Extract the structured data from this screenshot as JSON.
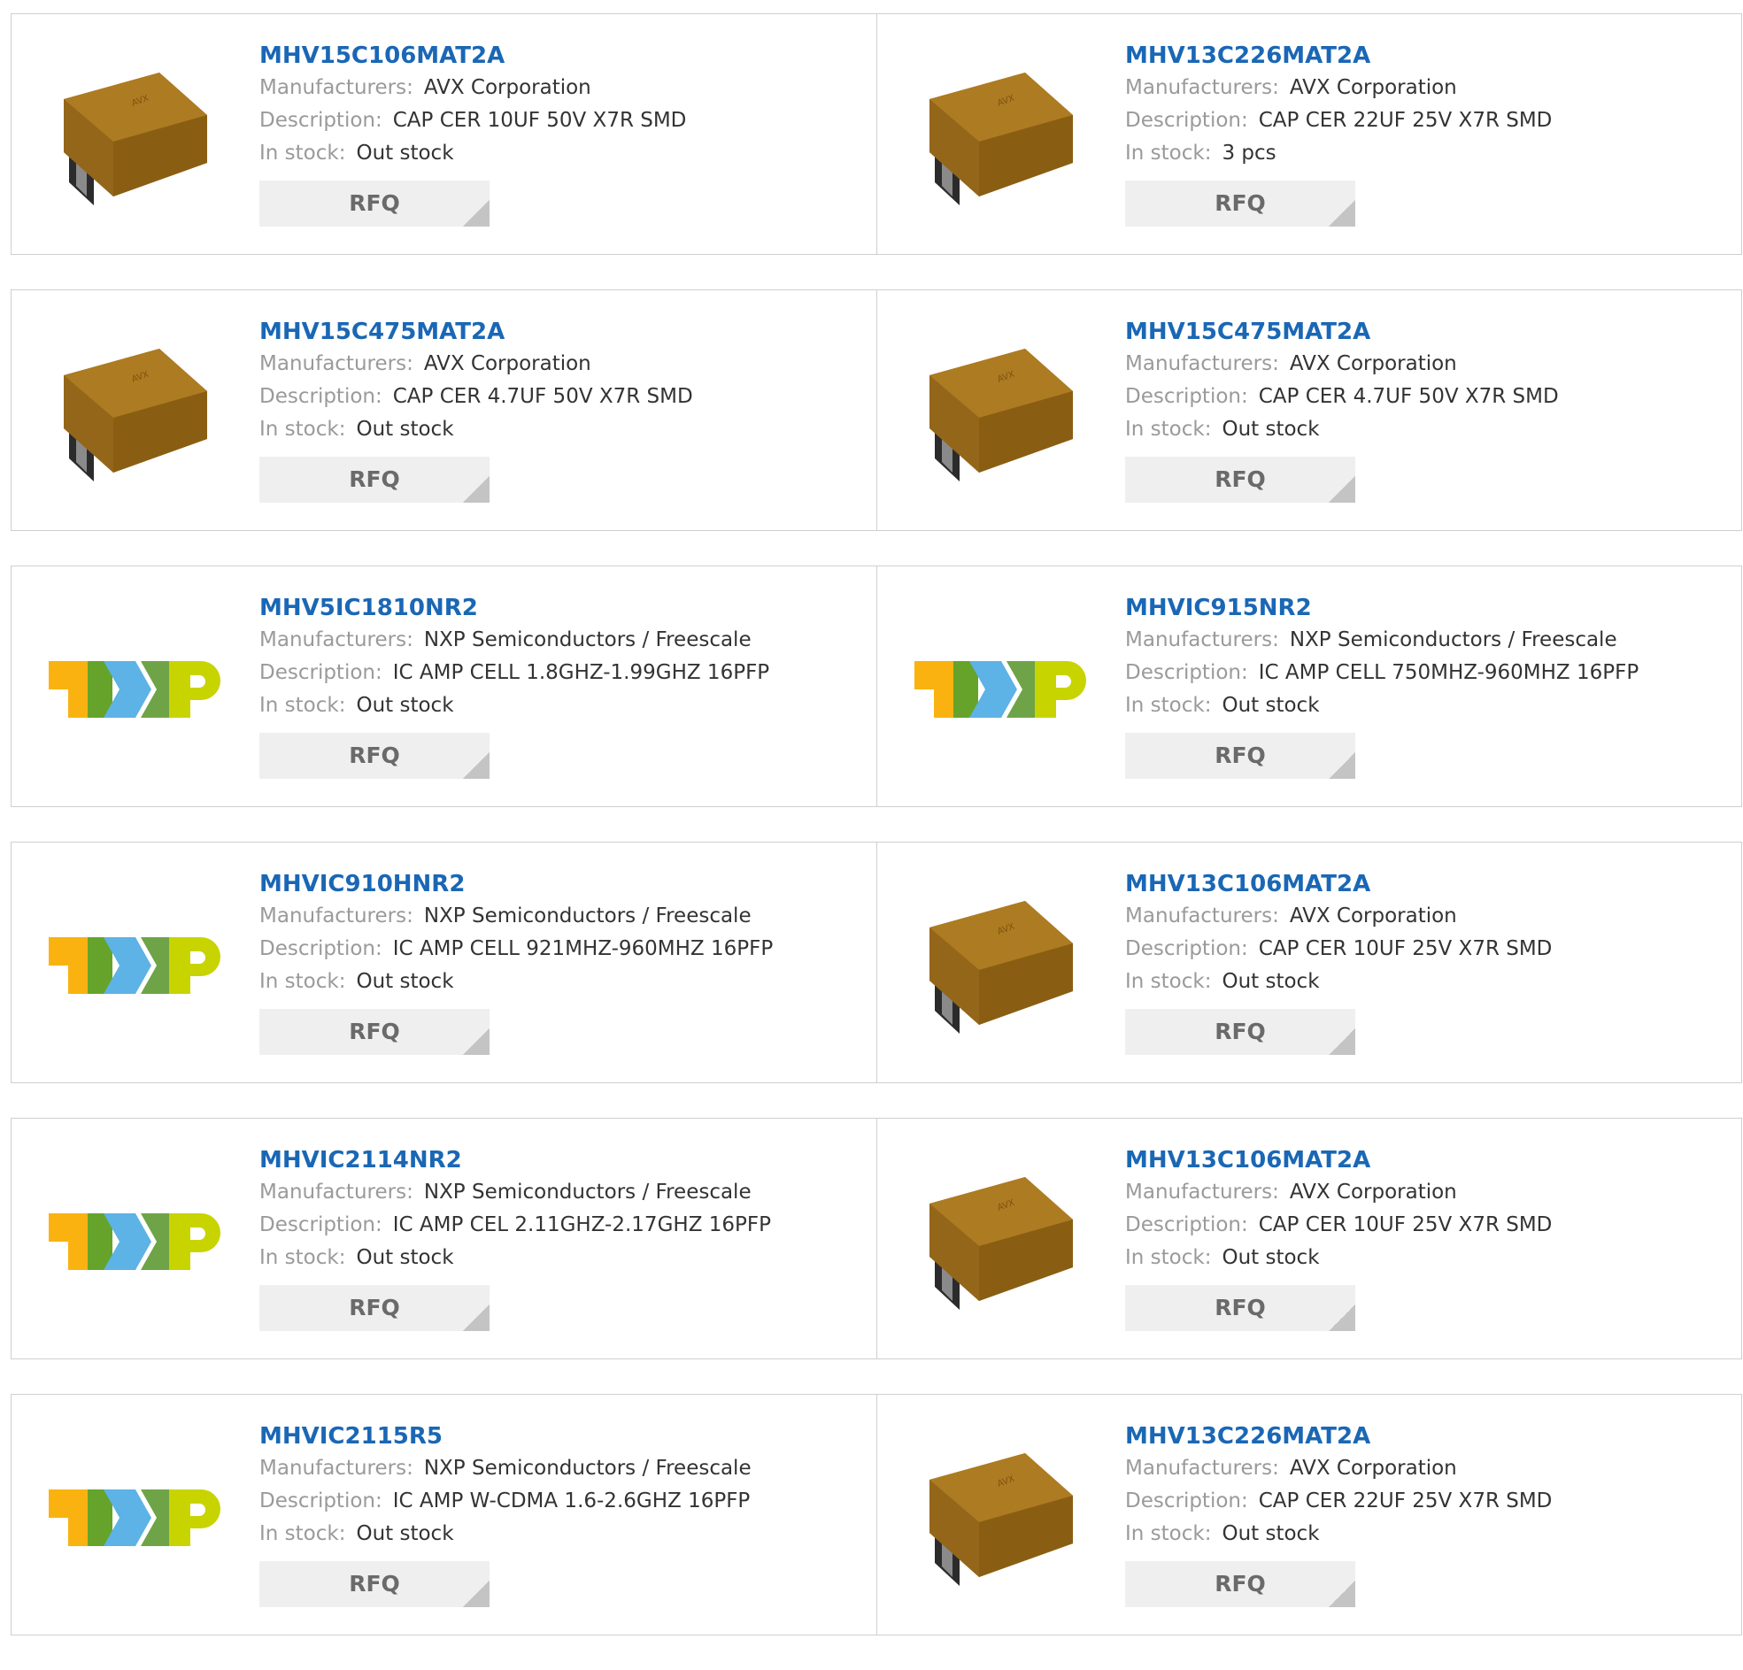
{
  "labels": {
    "manufacturers": "Manufacturers:",
    "description": "Description:",
    "in_stock": "In stock:",
    "rfq": "RFQ"
  },
  "colors": {
    "part_link": "#1a67b5",
    "label_gray": "#9a9a9a",
    "value_text": "#333333",
    "rfq_bg": "#efefef"
  },
  "products": [
    {
      "part": "MHV15C106MAT2A",
      "manufacturer": "AVX Corporation",
      "description": "CAP CER 10UF 50V X7R SMD",
      "stock": "Out stock",
      "image": "capacitor-image"
    },
    {
      "part": "MHV13C226MAT2A",
      "manufacturer": "AVX Corporation",
      "description": "CAP CER 22UF 25V X7R SMD",
      "stock": "3 pcs",
      "image": "capacitor-image"
    },
    {
      "part": "MHV15C475MAT2A",
      "manufacturer": "AVX Corporation",
      "description": "CAP CER 4.7UF 50V X7R SMD",
      "stock": "Out stock",
      "image": "capacitor-image"
    },
    {
      "part": "MHV15C475MAT2A",
      "manufacturer": "AVX Corporation",
      "description": "CAP CER 4.7UF 50V X7R SMD",
      "stock": "Out stock",
      "image": "capacitor-image"
    },
    {
      "part": "MHV5IC1810NR2",
      "manufacturer": "NXP Semiconductors / Freescale",
      "description": "IC AMP CELL 1.8GHZ-1.99GHZ 16PFP",
      "stock": "Out stock",
      "image": "nxp-logo"
    },
    {
      "part": "MHVIC915NR2",
      "manufacturer": "NXP Semiconductors / Freescale",
      "description": "IC AMP CELL 750MHZ-960MHZ 16PFP",
      "stock": "Out stock",
      "image": "nxp-logo"
    },
    {
      "part": "MHVIC910HNR2",
      "manufacturer": "NXP Semiconductors / Freescale",
      "description": "IC AMP CELL 921MHZ-960MHZ 16PFP",
      "stock": "Out stock",
      "image": "nxp-logo"
    },
    {
      "part": "MHV13C106MAT2A",
      "manufacturer": "AVX Corporation",
      "description": "CAP CER 10UF 25V X7R SMD",
      "stock": "Out stock",
      "image": "capacitor-image"
    },
    {
      "part": "MHVIC2114NR2",
      "manufacturer": "NXP Semiconductors / Freescale",
      "description": "IC AMP CEL 2.11GHZ-2.17GHZ 16PFP",
      "stock": "Out stock",
      "image": "nxp-logo"
    },
    {
      "part": "MHV13C106MAT2A",
      "manufacturer": "AVX Corporation",
      "description": "CAP CER 10UF 25V X7R SMD",
      "stock": "Out stock",
      "image": "capacitor-image"
    },
    {
      "part": "MHVIC2115R5",
      "manufacturer": "NXP Semiconductors / Freescale",
      "description": "IC AMP W-CDMA 1.6-2.6GHZ 16PFP",
      "stock": "Out stock",
      "image": "nxp-logo"
    },
    {
      "part": "MHV13C226MAT2A",
      "manufacturer": "AVX Corporation",
      "description": "CAP CER 22UF 25V X7R SMD",
      "stock": "Out stock",
      "image": "capacitor-image"
    }
  ]
}
